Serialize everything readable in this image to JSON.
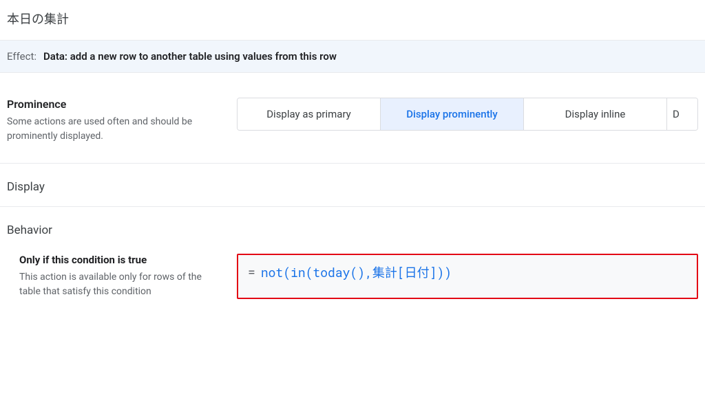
{
  "page": {
    "title": "本日の集計"
  },
  "effect": {
    "label": "Effect:",
    "value": "Data: add a new row to another table using values from this row"
  },
  "prominence": {
    "heading": "Prominence",
    "desc": "Some actions are used often and should be prominently displayed.",
    "options": {
      "primary": "Display as primary",
      "prominent": "Display prominently",
      "inline": "Display inline",
      "truncated": "D"
    }
  },
  "display": {
    "heading": "Display"
  },
  "behavior": {
    "heading": "Behavior",
    "condition": {
      "title": "Only if this condition is true",
      "desc": "This action is available only for rows of the table that satisfy this condition",
      "eq": "=",
      "expression": "not(in(today(),集計[日付]))"
    }
  }
}
